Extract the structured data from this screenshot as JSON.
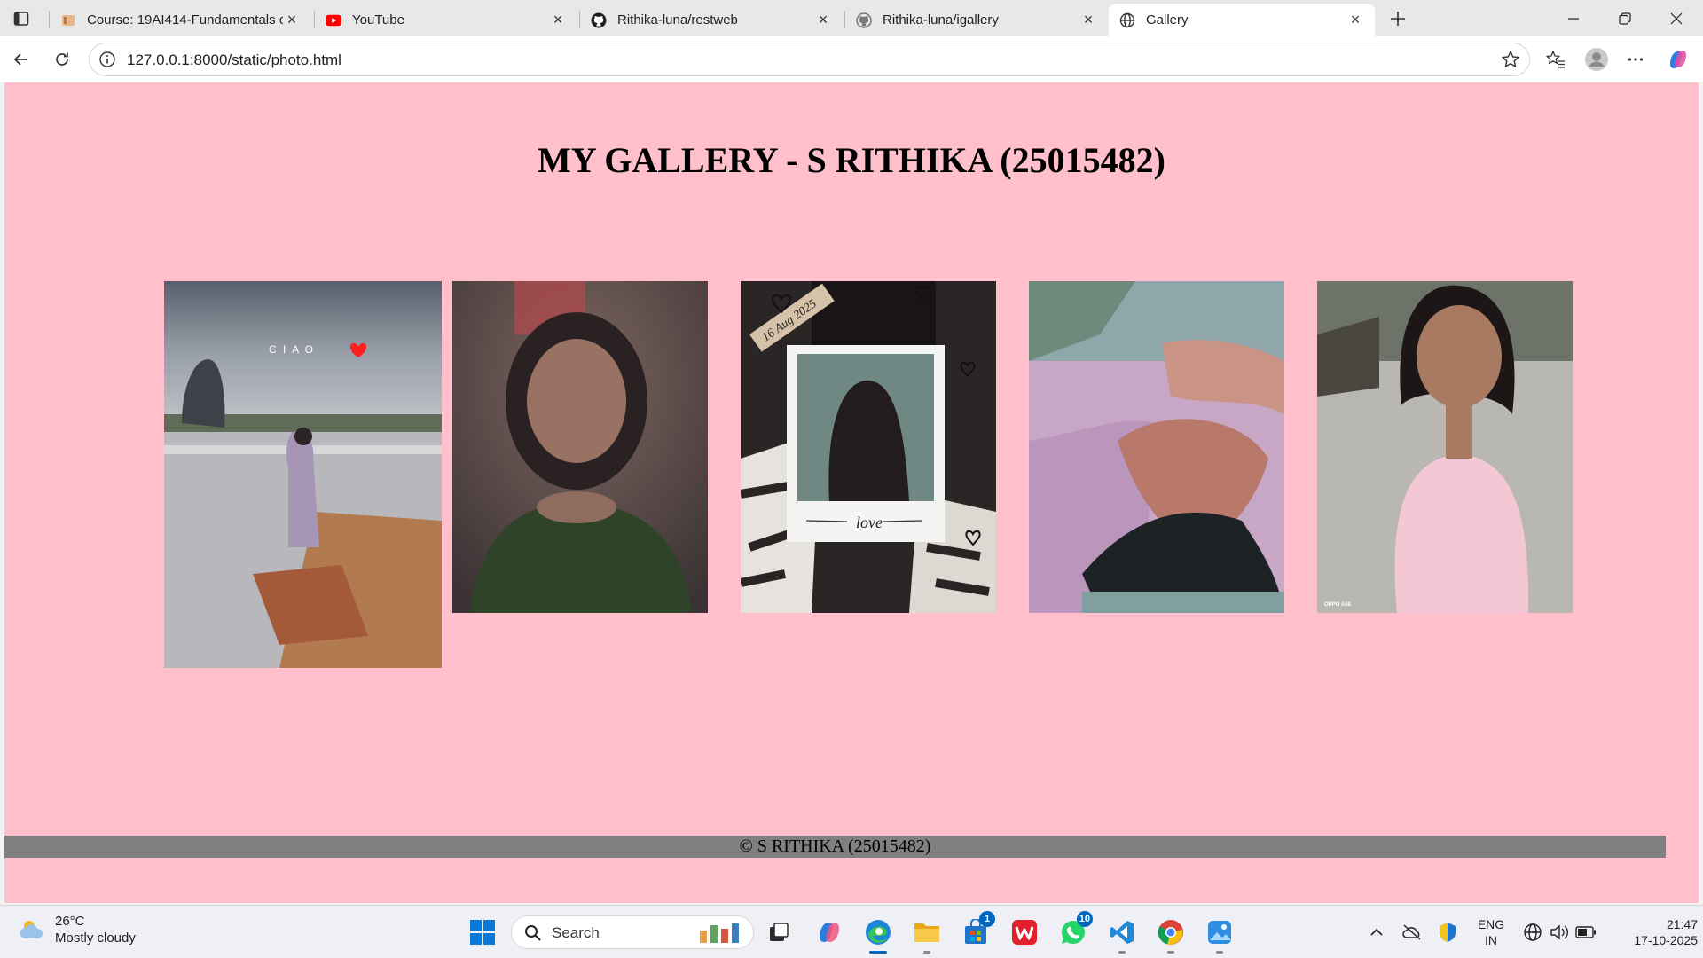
{
  "browser": {
    "tabs": [
      {
        "title": "Course: 19AI414-Fundamentals of",
        "favicon": "course-favicon-icon",
        "active": false
      },
      {
        "title": "YouTube",
        "favicon": "youtube-icon",
        "active": false
      },
      {
        "title": "Rithika-luna/restweb",
        "favicon": "github-icon",
        "active": false
      },
      {
        "title": "Rithika-luna/igallery",
        "favicon": "github-icon",
        "active": false
      },
      {
        "title": "Gallery",
        "favicon": "globe-icon",
        "active": true
      }
    ],
    "url": "127.0.0.1:8000/static/photo.html"
  },
  "page": {
    "title": "MY GALLERY - S RITHIKA (25015482)",
    "background": "#ffc0cb",
    "photos": [
      {
        "name": "photo-1",
        "caption": "C I A O",
        "scene": "statue-walkway"
      },
      {
        "name": "photo-2",
        "scene": "portrait-green-dress"
      },
      {
        "name": "photo-3",
        "date_tag": "16 Aug 2025",
        "polaroid_caption": "love",
        "scene": "polaroid-collage"
      },
      {
        "name": "photo-4",
        "scene": "lying-down-lavender"
      },
      {
        "name": "photo-5",
        "watermark": "OPPO A58",
        "scene": "portrait-pink-dress"
      }
    ],
    "footer": "© S RITHIKA (25015482)",
    "footer_color": "#808080"
  },
  "taskbar": {
    "weather": {
      "temp": "26°C",
      "condition": "Mostly cloudy"
    },
    "search_placeholder": "Search",
    "badges": {
      "store": "1",
      "whatsapp": "10"
    },
    "tray": {
      "lang_line1": "ENG",
      "lang_line2": "IN",
      "time": "21:47",
      "date": "17-10-2025"
    }
  }
}
